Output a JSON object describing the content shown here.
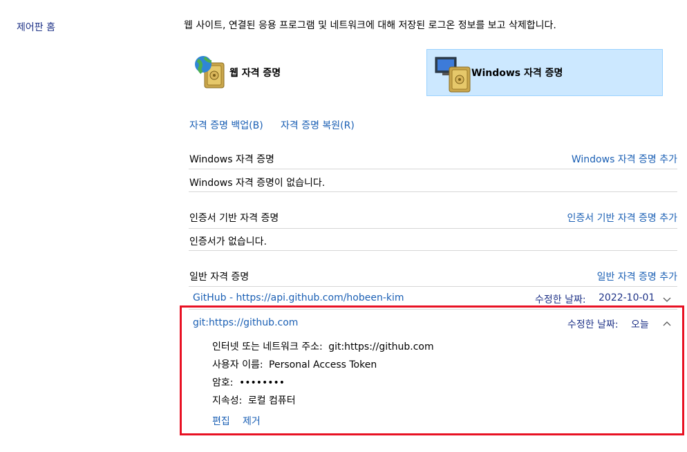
{
  "sidebar": {
    "home_label": "제어판 홈"
  },
  "header": {
    "description": "웹 사이트, 연결된 응용 프로그램 및 네트워크에 대해 저장된 로그온 정보를 보고 삭제합니다."
  },
  "vault_tabs": [
    {
      "label": "웹 자격 증명",
      "icon": "globe-vault-icon",
      "selected": false
    },
    {
      "label": "Windows 자격 증명",
      "icon": "monitor-vault-icon",
      "selected": true
    }
  ],
  "actions": {
    "backup": "자격 증명 백업(B)",
    "restore": "자격 증명 복원(R)"
  },
  "sections": {
    "windows": {
      "title": "Windows 자격 증명",
      "add": "Windows 자격 증명 추가",
      "empty": "Windows 자격 증명이 없습니다."
    },
    "certificate": {
      "title": "인증서 기반 자격 증명",
      "add": "인증서 기반 자격 증명 추가",
      "empty": "인증서가 없습니다."
    },
    "generic": {
      "title": "일반 자격 증명",
      "add": "일반 자격 증명 추가",
      "items": [
        {
          "name": "GitHub - https://api.github.com/hobeen-kim",
          "modified_label": "수정한 날짜:",
          "modified": "2022-10-01",
          "expanded": false
        },
        {
          "name": "git:https://github.com",
          "modified_label": "수정한 날짜:",
          "modified": "오늘",
          "expanded": true,
          "details": {
            "address_label": "인터넷 또는 네트워크 주소:",
            "address": "git:https://github.com",
            "user_label": "사용자 이름:",
            "user": "Personal Access Token",
            "password_label": "암호:",
            "password": "••••••••",
            "persistence_label": "지속성:",
            "persistence": "로컬 컴퓨터"
          },
          "edit": "편집",
          "remove": "제거"
        }
      ]
    }
  },
  "colors": {
    "link": "#1a5fb4",
    "selected_bg": "#cce8ff",
    "selected_border": "#99d1ff",
    "highlight_frame": "#e81123"
  }
}
